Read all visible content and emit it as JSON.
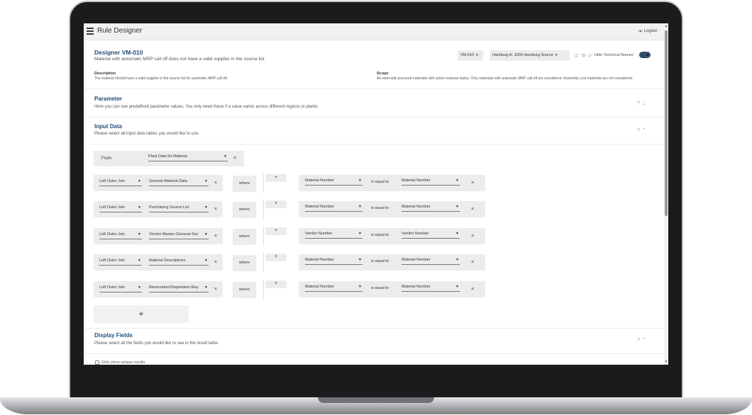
{
  "app": {
    "title": "Rule Designer",
    "logout_label": "Logout"
  },
  "designer": {
    "title": "Designer  VM-010",
    "subtitle": "Material with automatic MRP call off does not have a valid supplier in the source list",
    "rule_select": "VM-010",
    "plant_select": "Hamburg A: 1000 Hamburg Source",
    "hide_names_label": "Hide Technical Names",
    "hide_names_on": true
  },
  "description": {
    "label": "Description",
    "text": "The material should have a valid supplier in the source list for automatic MRP call off."
  },
  "scope": {
    "label": "Scope",
    "text": "All externally procured materials with active material status. Only materials with automatic MRP call off are considered. Assembly cost materials are not considered."
  },
  "parameter": {
    "title": "Parameter",
    "subtitle": "Here you can see predefined parameter values. You only need these if a value varies across different regions or plants.",
    "controls": "?⌄"
  },
  "input_data": {
    "title": "Input Data",
    "subtitle": "Please select all input data tables you would like to use.",
    "controls": "?⌃",
    "from_label": "From",
    "from_table": "Plant Data for Material",
    "where_label": "where",
    "equal_label": "is equal to",
    "joins": [
      {
        "type": "Left Outer Join",
        "table": "General Material Data",
        "left": "Material Number",
        "right": "Material Number"
      },
      {
        "type": "Left Outer Join",
        "table": "Purchasing Source List",
        "left": "Material Number",
        "right": "Material Number"
      },
      {
        "type": "Left Outer Join",
        "table": "Vendor Master (General Sec",
        "left": "Vendor Number",
        "right": "Vendor Number"
      },
      {
        "type": "Left Outer Join",
        "table": "Material Descriptions",
        "left": "Material Number",
        "right": "Material Number"
      },
      {
        "type": "Left Outer Join",
        "table": "Reservation/Dependent Req",
        "left": "Material Number",
        "right": "Material Number"
      }
    ],
    "add_label": "+"
  },
  "display_fields": {
    "title": "Display Fields",
    "subtitle": "Please select all the fields you would like to see in the result table.",
    "controls": "?⌃",
    "unique_label": "Only show unique results"
  },
  "icons": {
    "menu": "menu-icon",
    "logout": "logout-icon",
    "comment": "comment-icon",
    "save": "save-icon",
    "run": "play-icon",
    "close": "close-icon",
    "dropdown": "caret-down-icon"
  }
}
